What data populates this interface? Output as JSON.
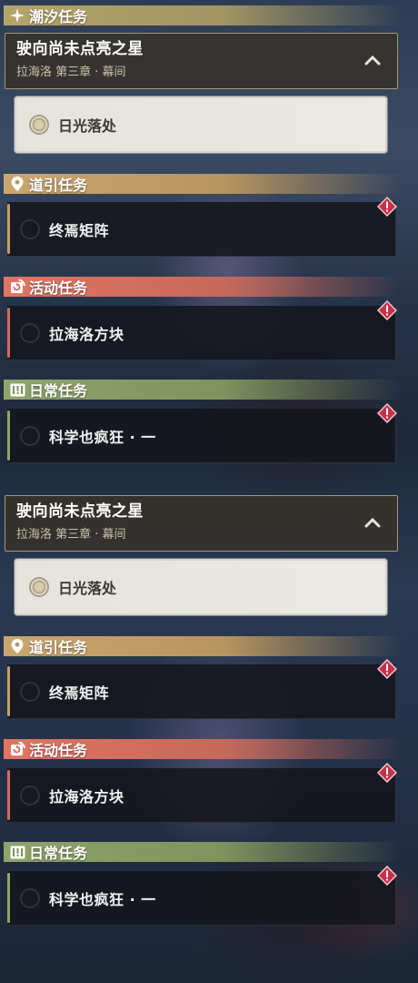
{
  "panels": [
    {
      "category_tide": {
        "label": "潮汐任务",
        "icon": "sparkle-icon"
      },
      "main_quest": {
        "title": "驶向尚未点亮之星",
        "subtitle": "拉海洛 第三章 · 幕间",
        "expanded": true
      },
      "current_step": {
        "label": "日光落处"
      },
      "sections": [
        {
          "category": "道引任务",
          "icon": "location-pin-icon",
          "task": "终焉矩阵",
          "alert": true
        },
        {
          "category": "活动任务",
          "icon": "event-refresh-icon",
          "task": "拉海洛方块",
          "alert": true
        },
        {
          "category": "日常任务",
          "icon": "exclamation-box-icon",
          "task": "科学也疯狂 · 一",
          "alert": true
        }
      ]
    },
    {
      "main_quest": {
        "title": "驶向尚未点亮之星",
        "subtitle": "拉海洛 第三章 · 幕间",
        "expanded": true
      },
      "current_step": {
        "label": "日光落处"
      },
      "sections": [
        {
          "category": "道引任务",
          "icon": "location-pin-icon",
          "task": "终焉矩阵",
          "alert": true
        },
        {
          "category": "活动任务",
          "icon": "event-refresh-icon",
          "task": "拉海洛方块",
          "alert": true
        },
        {
          "category": "日常任务",
          "icon": "exclamation-box-icon",
          "task": "科学也疯狂 · 一",
          "alert": true
        }
      ]
    }
  ],
  "colors": {
    "tide": "#b5a46a",
    "guide": "#caa66e",
    "event": "#e07562",
    "daily": "#8fa46a",
    "alert": "#c8304a"
  }
}
